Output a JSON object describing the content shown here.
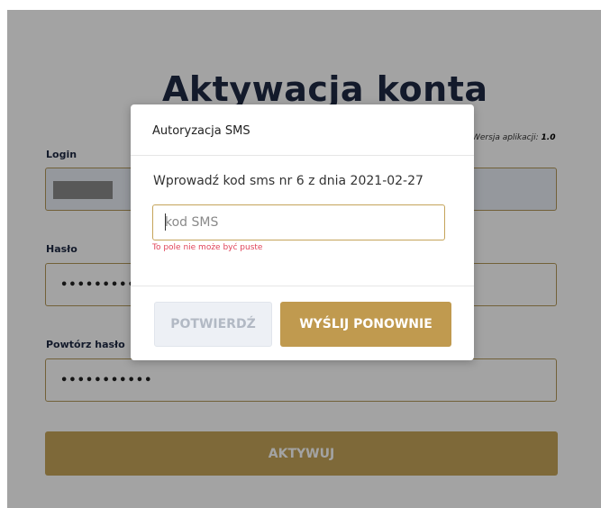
{
  "page": {
    "title": "Aktywacja konta",
    "version_label": "Wersja aplikacji:",
    "version_value": "1.0"
  },
  "form": {
    "login_label": "Login",
    "password_label": "Hasło",
    "password_value": "•••••••••••",
    "repeat_password_label": "Powtórz hasło",
    "repeat_password_value": "•••••••••••",
    "submit_label": "AKTYWUJ"
  },
  "modal": {
    "title": "Autoryzacja SMS",
    "message": "Wprowadź kod sms nr 6 z dnia 2021-02-27",
    "input_placeholder": "kod SMS",
    "error": "To pole nie może być puste",
    "confirm_label": "POTWIERDŹ",
    "resend_label": "WYŚLIJ PONOWNIE"
  },
  "colors": {
    "accent": "#c09a4f",
    "error": "#e0445a",
    "title": "#1f2a44"
  }
}
